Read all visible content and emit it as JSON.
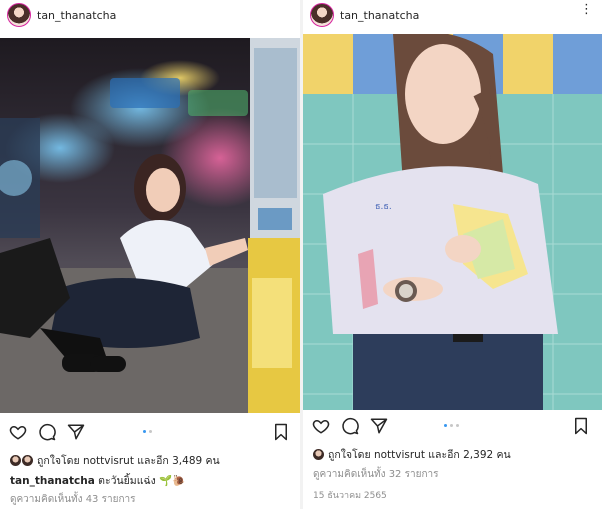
{
  "posts": [
    {
      "username": "tan_thanatcha",
      "more_icon": "⋮",
      "liked_by_text": "ถูกใจโดย nottvisrut และอีก 3,489 คน",
      "caption_user": "tan_thanatcha",
      "caption_text": "ตะวันยิ้มแฉ่ง 🌱🐌",
      "comments_text": "ดูความคิดเห็นทั้ง 43 รายการ",
      "date": ""
    },
    {
      "username": "tan_thanatcha",
      "more_icon": "⋮",
      "liked_by_text": "ถูกใจโดย nottvisrut และอีก 2,392 คน",
      "caption_user": "",
      "caption_text": "",
      "comments_text": "ดูความคิดเห็นทั้ง 32 รายการ",
      "date": "15 ธันวาคม 2565"
    }
  ],
  "icons": [
    "heart-icon",
    "comment-icon",
    "share-icon",
    "bookmark-icon",
    "more-icon"
  ],
  "colors": {
    "text": "#262626",
    "muted": "#8e8e8e",
    "active_dot": "#3897f0",
    "inactive_dot": "#c7c7c7"
  }
}
